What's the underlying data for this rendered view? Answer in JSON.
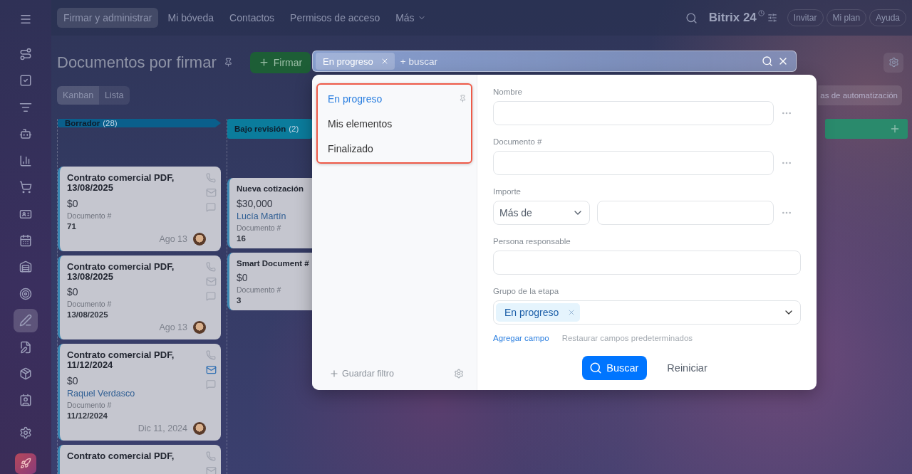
{
  "sidebar": {
    "items": [
      {
        "selected": false
      },
      {
        "selected": false
      },
      {
        "selected": false
      },
      {
        "selected": false
      },
      {
        "selected": false
      },
      {
        "selected": false
      },
      {
        "selected": false
      },
      {
        "selected": false
      },
      {
        "selected": false
      },
      {
        "selected": false
      },
      {
        "selected": true
      },
      {
        "selected": false
      },
      {
        "selected": false
      },
      {
        "selected": false
      },
      {
        "selected": false
      }
    ]
  },
  "nav": {
    "tabs": [
      {
        "label": "Firmar y administrar",
        "selected": true,
        "kind": "link"
      },
      {
        "label": "Mi bóveda",
        "selected": false,
        "kind": "link"
      },
      {
        "label": "Contactos",
        "selected": false,
        "kind": "link"
      },
      {
        "label": "Permisos de acceso",
        "selected": false,
        "kind": "link"
      },
      {
        "label": "Más",
        "selected": false,
        "kind": "dropdown"
      }
    ],
    "logo": "Bitrix 24",
    "buttons": [
      "Invitar",
      "Mi plan",
      "Ayuda"
    ]
  },
  "header": {
    "title": "Documentos por firmar",
    "add_button": "Firmar",
    "automation_button": "as de automatización",
    "views": [
      {
        "label": "Kanban",
        "selected": true
      },
      {
        "label": "Lista",
        "selected": false
      }
    ]
  },
  "kanban": {
    "columns": [
      {
        "title": "Borrador",
        "count": "(28)",
        "color": "#0a5f8c",
        "cards": [
          {
            "title": "Contrato comercial PDF, 13/08/2025",
            "amount": "$0",
            "doc_label": "Documento #",
            "doc_value": "71",
            "date": "Ago 13",
            "mail_active": false
          },
          {
            "title": "Contrato comercial PDF, 13/08/2025",
            "amount": "$0",
            "doc_label": "Documento #",
            "doc_value": "13/08/2025",
            "date": "Ago 13",
            "mail_active": false
          },
          {
            "title": "Contrato comercial PDF, 11/12/2024",
            "amount": "$0",
            "person": "Raquel Verdasco",
            "doc_label": "Documento #",
            "doc_value": "11/12/2024",
            "date": "Dic 11, 2024",
            "mail_active": true
          },
          {
            "title": "Contrato comercial PDF,",
            "mail_active": false
          }
        ]
      },
      {
        "title": "Bajo revisión",
        "count": "(2)",
        "color": "#0b7c9c",
        "cards": [
          {
            "title": "Nueva cotización",
            "amount": "$30,000",
            "person": "Lucía Martín",
            "doc_label": "Documento #",
            "doc_value": "16"
          },
          {
            "title": "Smart Document #",
            "amount": "$0",
            "doc_label": "Documento #",
            "doc_value": "3"
          }
        ]
      },
      {
        "color": "#2a8a6c"
      }
    ]
  },
  "filter": {
    "tags": [
      "En progreso"
    ],
    "placeholder": "+ buscar",
    "presets": [
      {
        "label": "En progreso",
        "selected": true,
        "pinned": true
      },
      {
        "label": "Mis elementos",
        "selected": false,
        "pinned": false
      },
      {
        "label": "Finalizado",
        "selected": false,
        "pinned": false
      }
    ],
    "save_filter": "Guardar filtro",
    "fields": [
      {
        "kind": "text",
        "label": "Nombre"
      },
      {
        "kind": "text",
        "label": "Documento #"
      },
      {
        "kind": "range",
        "label": "Importe",
        "operator": "Más de"
      },
      {
        "kind": "user",
        "label": "Persona responsable"
      },
      {
        "kind": "tags",
        "label": "Grupo de la etapa",
        "tags": [
          "En progreso"
        ]
      }
    ],
    "add_field": "Agregar campo",
    "restore": "Restaurar campos predeterminados",
    "search_button": "Buscar",
    "reset_button": "Reiniciar"
  }
}
